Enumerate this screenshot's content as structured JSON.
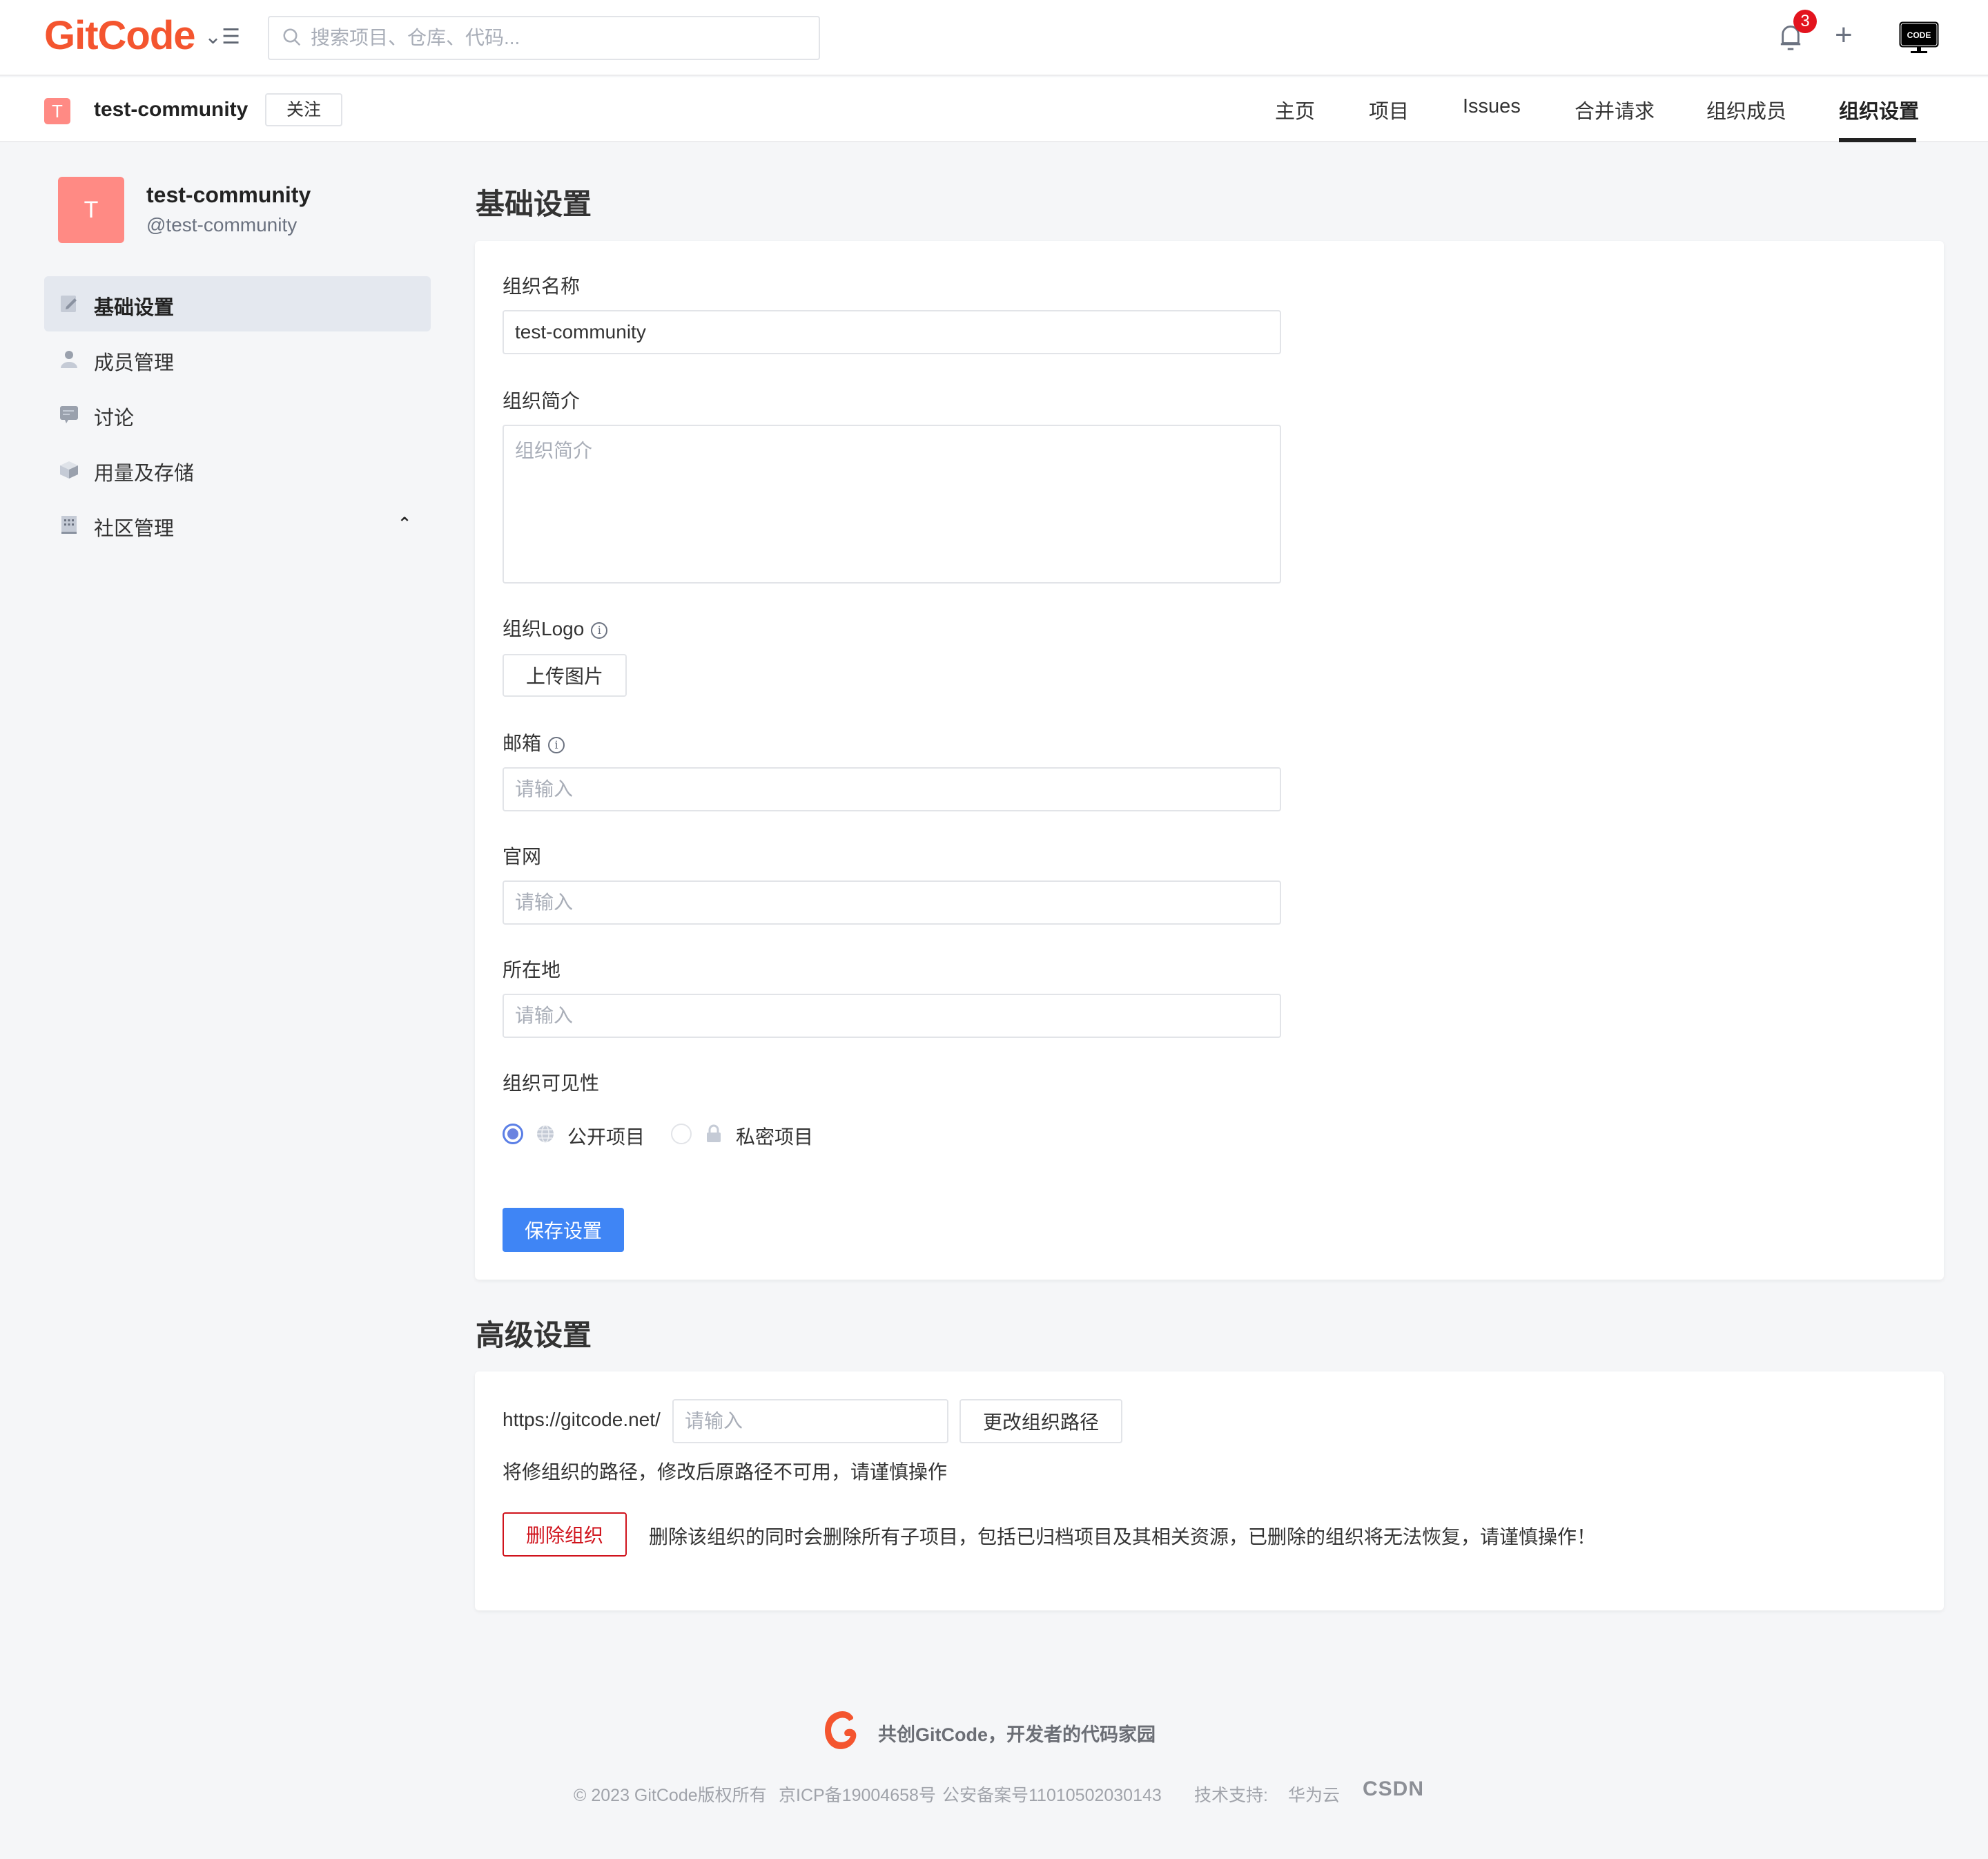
{
  "header": {
    "logo_text": "GitCode",
    "search_placeholder": "搜索项目、仓库、代码...",
    "notification_count": "3",
    "plus_label": "+",
    "code_badge": "CODE"
  },
  "org_bar": {
    "badge_letter": "T",
    "name": "test-community",
    "follow_label": "关注",
    "tabs": [
      {
        "label": "主页",
        "active": false
      },
      {
        "label": "项目",
        "active": false
      },
      {
        "label": "Issues",
        "active": false
      },
      {
        "label": "合并请求",
        "active": false
      },
      {
        "label": "组织成员",
        "active": false
      },
      {
        "label": "组织设置",
        "active": true
      }
    ]
  },
  "sidebar": {
    "avatar_letter": "T",
    "name": "test-community",
    "handle": "@test-community",
    "items": [
      {
        "label": "基础设置",
        "icon": "edit-icon",
        "active": true
      },
      {
        "label": "成员管理",
        "icon": "user-icon",
        "active": false
      },
      {
        "label": "讨论",
        "icon": "chat-icon",
        "active": false
      },
      {
        "label": "用量及存储",
        "icon": "box-icon",
        "active": false
      },
      {
        "label": "社区管理",
        "icon": "building-icon",
        "active": false,
        "expanded": true
      }
    ]
  },
  "basic": {
    "title": "基础设置",
    "name_label": "组织名称",
    "name_value": "test-community",
    "intro_label": "组织简介",
    "intro_placeholder": "组织简介",
    "logo_label": "组织Logo",
    "upload_label": "上传图片",
    "email_label": "邮箱",
    "email_placeholder": "请输入",
    "website_label": "官网",
    "website_placeholder": "请输入",
    "location_label": "所在地",
    "location_placeholder": "请输入",
    "visibility_label": "组织可见性",
    "visibility_options": [
      {
        "label": "公开项目",
        "icon": "globe-icon",
        "checked": true
      },
      {
        "label": "私密项目",
        "icon": "lock-icon",
        "checked": false
      }
    ],
    "save_label": "保存设置"
  },
  "advanced": {
    "title": "高级设置",
    "url_prefix": "https://gitcode.net/",
    "path_placeholder": "请输入",
    "change_path_label": "更改组织路径",
    "path_warning": "将修组织的路径，修改后原路径不可用，请谨慎操作",
    "delete_label": "删除组织",
    "delete_warning": "删除该组织的同时会删除所有子项目，包括已归档项目及其相关资源，已删除的组织将无法恢复，请谨慎操作！"
  },
  "footer": {
    "slogan": "共创GitCode，开发者的代码家园",
    "copyright": "© 2023 GitCode版权所有",
    "icp": "京ICP备19004658号",
    "police": "公安备案号11010502030143",
    "support_label": "技术支持:",
    "huawei": "华为云",
    "csdn": "CSDN"
  },
  "colors": {
    "brand": "#f4552f",
    "primary": "#3f85f5",
    "danger": "#d0131c",
    "avatar": "#ff8a84"
  }
}
